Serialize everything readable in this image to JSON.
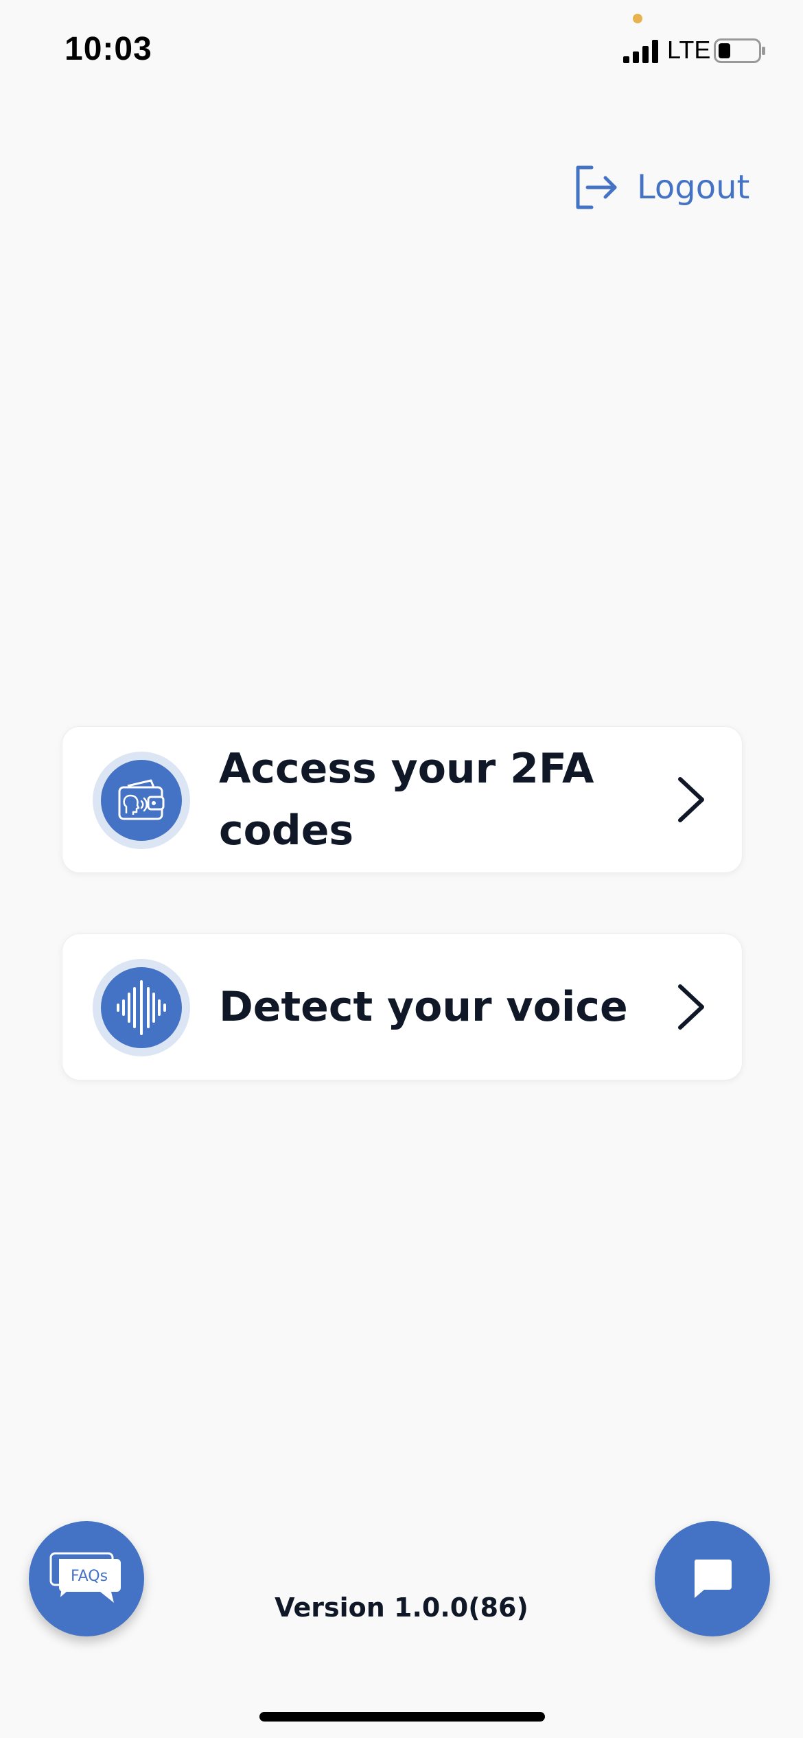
{
  "status_bar": {
    "time": "10:03",
    "network": "LTE",
    "icons": [
      "signal-icon",
      "battery-icon"
    ]
  },
  "header": {
    "logout_label": "Logout",
    "logout_icon": "logout-icon"
  },
  "menu": {
    "items": [
      {
        "label": "Access your 2FA codes",
        "icon": "wallet-voice-icon"
      },
      {
        "label": "Detect your voice",
        "icon": "sound-wave-icon"
      }
    ]
  },
  "footer": {
    "version": "Version 1.0.0(86)",
    "faq_icon_text": "FAQs",
    "faq_icon": "faq-bubble-icon",
    "chat_icon": "chat-bubble-icon"
  },
  "colors": {
    "accent": "#4472c4",
    "accent_light": "#dce5f4",
    "background": "#f9f9f9",
    "text": "#101828"
  }
}
